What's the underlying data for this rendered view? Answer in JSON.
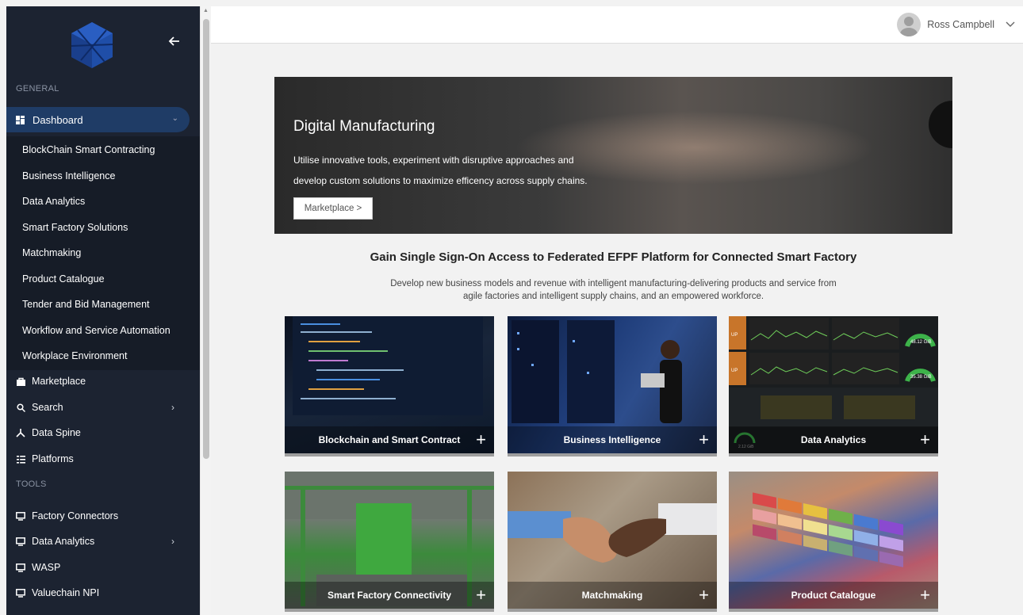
{
  "sidebar": {
    "sections": {
      "general": "GENERAL",
      "tools": "TOOLS"
    },
    "dashboard": {
      "label": "Dashboard"
    },
    "dashboard_items": [
      "BlockChain Smart Contracting",
      "Business Intelligence",
      "Data Analytics",
      "Smart Factory Solutions",
      "Matchmaking",
      "Product Catalogue",
      "Tender and Bid Management",
      "Workflow and Service Automation",
      "Workplace Environment"
    ],
    "nav": {
      "marketplace": "Marketplace",
      "search": "Search",
      "data_spine": "Data Spine",
      "platforms": "Platforms"
    },
    "tools": {
      "factory_connectors": "Factory Connectors",
      "data_analytics": "Data Analytics",
      "wasp": "WASP",
      "valuechain": "Valuechain NPI"
    }
  },
  "header": {
    "user_name": "Ross Campbell"
  },
  "hero": {
    "title": "Digital Manufacturing",
    "description": "Utilise innovative tools, experiment with disruptive approaches and develop custom solutions to maximize efficency across supply chains.",
    "button_label": "Marketplace >"
  },
  "main": {
    "headline": "Gain Single Sign-On Access to Federated EFPF Platform for Connected Smart Factory",
    "subtext_line1": "Develop new business models and revenue with intelligent manufacturing-delivering products and service from",
    "subtext_line2": "agile factories and intelligent supply chains, and an empowered workforce."
  },
  "tiles": [
    {
      "label": "Blockchain and Smart Contract"
    },
    {
      "label": "Business Intelligence"
    },
    {
      "label": "Data Analytics"
    },
    {
      "label": "Smart Factory Connectivity"
    },
    {
      "label": "Matchmaking"
    },
    {
      "label": "Product Catalogue"
    }
  ],
  "data_tile_readouts": [
    "UP",
    "UP",
    "48.12 GiB",
    "35.38 GiB",
    "2.12 GiB"
  ],
  "colors": {
    "sidebar_bg": "#1c2331",
    "active_item": "#1f3c66",
    "tile_border": "#9e9e9e"
  }
}
